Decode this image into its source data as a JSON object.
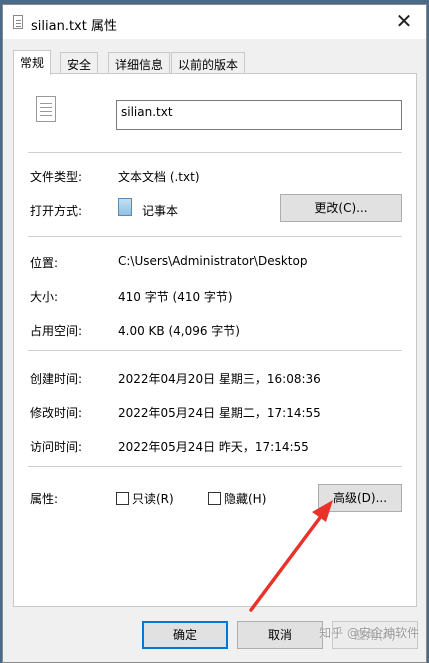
{
  "window": {
    "title": "silian.txt 属性",
    "close_glyph": "✕"
  },
  "tabs": [
    {
      "label": "常规",
      "active": true
    },
    {
      "label": "安全",
      "active": false
    },
    {
      "label": "详细信息",
      "active": false
    },
    {
      "label": "以前的版本",
      "active": false
    }
  ],
  "general": {
    "file_name": "silian.txt",
    "file_type_label": "文件类型:",
    "file_type_value": "文本文档 (.txt)",
    "opens_with_label": "打开方式:",
    "opens_with_value": "记事本",
    "change_button": "更改(C)...",
    "location_label": "位置:",
    "location_value": "C:\\Users\\Administrator\\Desktop",
    "size_label": "大小:",
    "size_value": "410 字节 (410 字节)",
    "size_on_disk_label": "占用空间:",
    "size_on_disk_value": "4.00 KB (4,096 字节)",
    "created_label": "创建时间:",
    "created_value": "2022年04月20日 星期三，16:08:36",
    "modified_label": "修改时间:",
    "modified_value": "2022年05月24日 星期二，17:14:55",
    "accessed_label": "访问时间:",
    "accessed_value": "2022年05月24日 昨天，17:14:55",
    "attributes_label": "属性:",
    "readonly_label": "只读(R)",
    "readonly_checked": false,
    "hidden_label": "隐藏(H)",
    "hidden_checked": false,
    "advanced_button": "高级(D)..."
  },
  "footer": {
    "ok": "确定",
    "cancel": "取消",
    "apply": "应用(A)"
  },
  "watermark": "知乎 @安企神软件",
  "colors": {
    "annotation_arrow": "#e8322a",
    "primary_border": "#0078d7"
  }
}
